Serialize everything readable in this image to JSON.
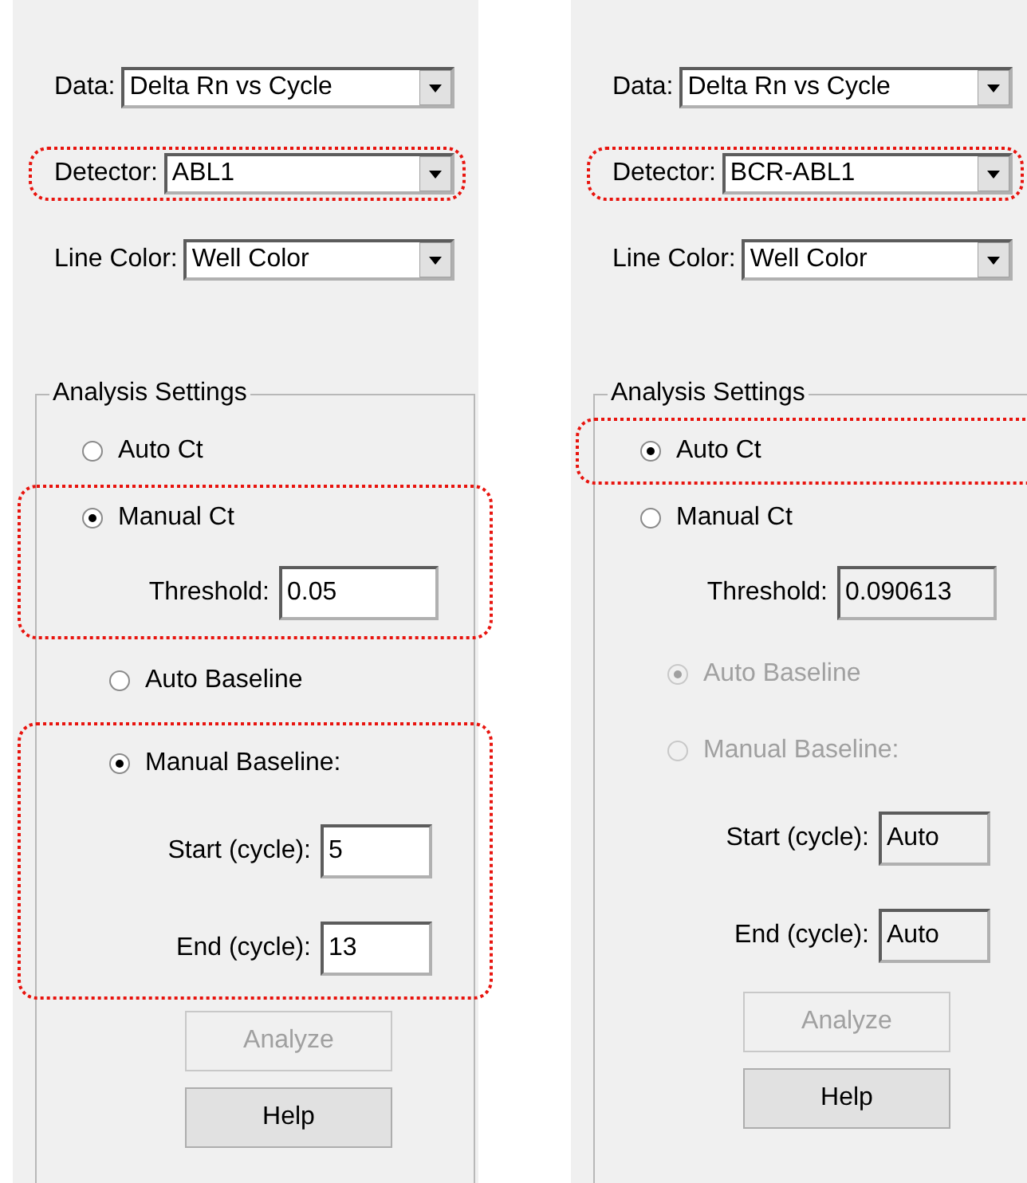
{
  "panels": [
    {
      "selectors": [
        {
          "label": "Data:",
          "value": "Delta Rn vs Cycle",
          "highlighted": false
        },
        {
          "label": "Detector:",
          "value": "ABL1",
          "highlighted": true
        },
        {
          "label": "Line Color:",
          "value": "Well Color",
          "highlighted": false
        }
      ],
      "analysis_settings": {
        "title": "Analysis Settings",
        "groups": [
          {
            "highlighted": false,
            "items": [
              {
                "kind": "ct_radio",
                "label": "Auto Ct",
                "selected": false,
                "disabled": false
              }
            ]
          },
          {
            "highlighted": true,
            "items": [
              {
                "kind": "ct_radio",
                "label": "Manual Ct",
                "selected": true,
                "disabled": false
              },
              {
                "kind": "threshold_field",
                "label": "Threshold:",
                "value": "0.05",
                "readonly": false
              }
            ]
          },
          {
            "highlighted": false,
            "items": [
              {
                "kind": "baseline_radio",
                "label": "Auto Baseline",
                "selected": false,
                "disabled": false
              }
            ]
          },
          {
            "highlighted": true,
            "items": [
              {
                "kind": "baseline_radio",
                "label": "Manual Baseline:",
                "selected": true,
                "disabled": false
              },
              {
                "kind": "cycle_field",
                "label": "Start (cycle):",
                "value": "5",
                "readonly": false
              },
              {
                "kind": "cycle_field",
                "label": "End (cycle):",
                "value": "13",
                "readonly": false
              }
            ]
          },
          {
            "highlighted": false,
            "items": [
              {
                "kind": "button",
                "label": "Analyze",
                "disabled": true
              },
              {
                "kind": "button",
                "label": "Help",
                "disabled": false
              }
            ]
          }
        ]
      }
    },
    {
      "selectors": [
        {
          "label": "Data:",
          "value": "Delta Rn vs Cycle",
          "highlighted": false
        },
        {
          "label": "Detector:",
          "value": "BCR-ABL1",
          "highlighted": true
        },
        {
          "label": "Line Color:",
          "value": "Well Color",
          "highlighted": false
        }
      ],
      "analysis_settings": {
        "title": "Analysis Settings",
        "groups": [
          {
            "highlighted": true,
            "items": [
              {
                "kind": "ct_radio",
                "label": "Auto Ct",
                "selected": true,
                "disabled": false
              }
            ]
          },
          {
            "highlighted": false,
            "items": [
              {
                "kind": "ct_radio",
                "label": "Manual Ct",
                "selected": false,
                "disabled": false
              },
              {
                "kind": "threshold_field",
                "label": "Threshold:",
                "value": "0.090613",
                "readonly": true
              },
              {
                "kind": "baseline_radio",
                "label": "Auto Baseline",
                "selected": true,
                "disabled": true
              },
              {
                "kind": "baseline_radio",
                "label": "Manual Baseline:",
                "selected": false,
                "disabled": true
              },
              {
                "kind": "cycle_field",
                "label": "Start (cycle):",
                "value": "Auto",
                "readonly": true
              },
              {
                "kind": "cycle_field",
                "label": "End (cycle):",
                "value": "Auto",
                "readonly": true
              },
              {
                "kind": "button",
                "label": "Analyze",
                "disabled": true
              },
              {
                "kind": "button",
                "label": "Help",
                "disabled": false
              }
            ]
          }
        ]
      }
    }
  ]
}
